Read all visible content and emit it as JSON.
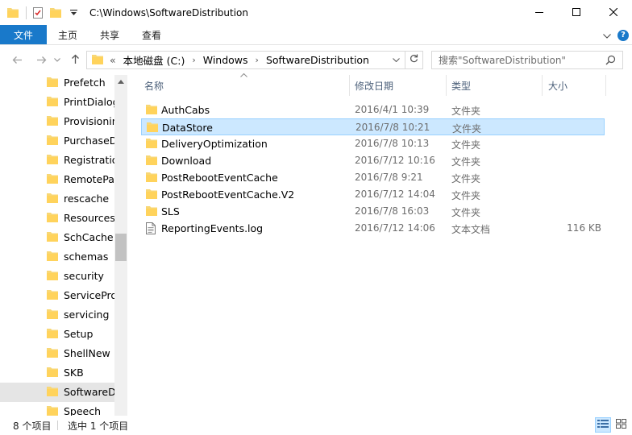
{
  "window": {
    "title": "C:\\Windows\\SoftwareDistribution",
    "minimize_icon": "minimize-icon",
    "maximize_icon": "maximize-icon",
    "close_icon": "close-icon"
  },
  "ribbon": {
    "tabs": [
      "文件",
      "主页",
      "共享",
      "查看"
    ]
  },
  "address": {
    "overflow": "«",
    "crumbs": [
      "本地磁盘 (C:)",
      "Windows",
      "SoftwareDistribution"
    ]
  },
  "search": {
    "placeholder": "搜索\"SoftwareDistribution\""
  },
  "nav": {
    "items": [
      "Prefetch",
      "PrintDialog",
      "Provisioning",
      "PurchaseDialog",
      "Registration",
      "RemotePackages",
      "rescache",
      "Resources",
      "SchCache",
      "schemas",
      "security",
      "ServiceProfiles",
      "servicing",
      "Setup",
      "ShellNew",
      "SKB",
      "SoftwareDistribution",
      "Speech"
    ],
    "selected_index": 16
  },
  "columns": {
    "name": "名称",
    "date": "修改日期",
    "type": "类型",
    "size": "大小"
  },
  "files": [
    {
      "name": "AuthCabs",
      "date": "2016/4/1 10:39",
      "type": "文件夹",
      "size": "",
      "icon": "folder-icon"
    },
    {
      "name": "DataStore",
      "date": "2016/7/8 10:21",
      "type": "文件夹",
      "size": "",
      "icon": "folder-icon"
    },
    {
      "name": "DeliveryOptimization",
      "date": "2016/7/8 10:13",
      "type": "文件夹",
      "size": "",
      "icon": "folder-icon"
    },
    {
      "name": "Download",
      "date": "2016/7/12 10:16",
      "type": "文件夹",
      "size": "",
      "icon": "folder-icon"
    },
    {
      "name": "PostRebootEventCache",
      "date": "2016/7/8 9:21",
      "type": "文件夹",
      "size": "",
      "icon": "folder-icon"
    },
    {
      "name": "PostRebootEventCache.V2",
      "date": "2016/7/12 14:04",
      "type": "文件夹",
      "size": "",
      "icon": "folder-icon"
    },
    {
      "name": "SLS",
      "date": "2016/7/8 16:03",
      "type": "文件夹",
      "size": "",
      "icon": "folder-icon"
    },
    {
      "name": "ReportingEvents.log",
      "date": "2016/7/12 14:06",
      "type": "文本文档",
      "size": "116 KB",
      "icon": "text-document-icon"
    }
  ],
  "selected_file_index": 1,
  "status": {
    "count": "8 个项目",
    "selection": "选中 1 个项目"
  },
  "colors": {
    "accent": "#1979ca",
    "folder": "#ffd35c",
    "selection_bg": "#cce8ff",
    "selection_border": "#99d1ff"
  }
}
